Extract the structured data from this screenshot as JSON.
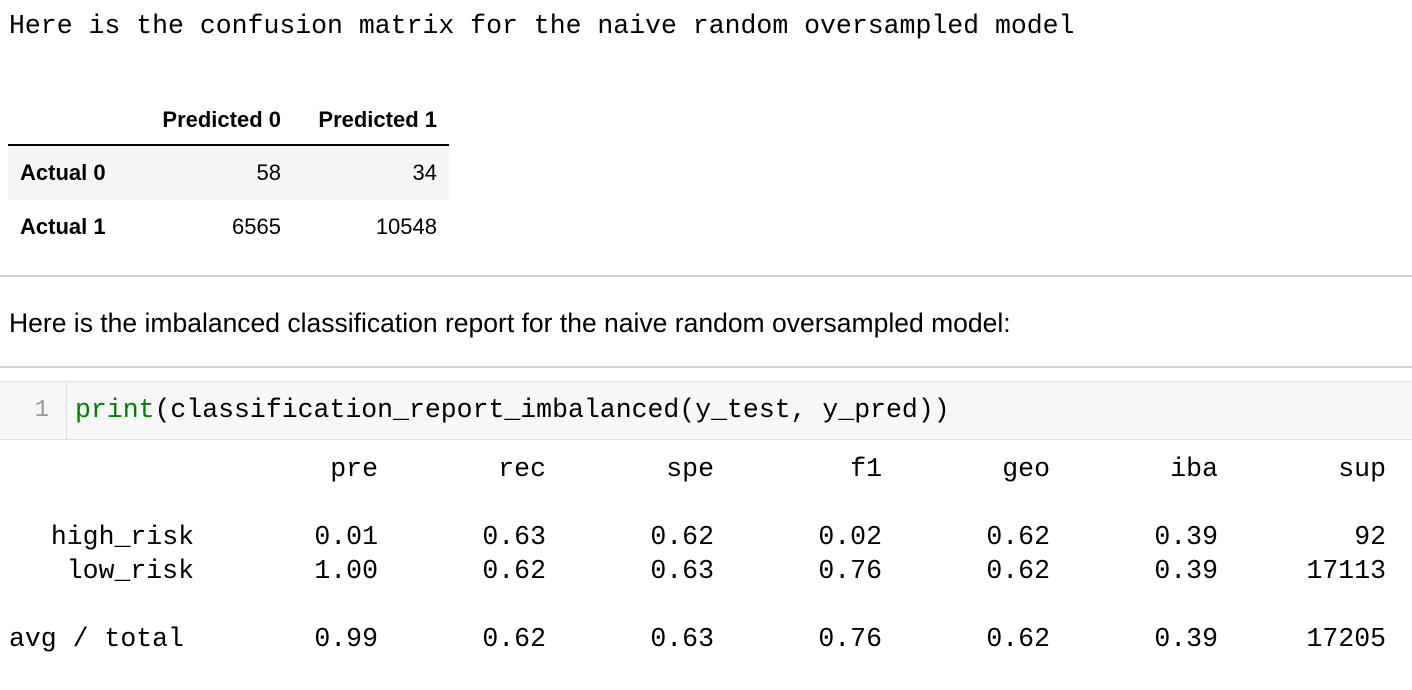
{
  "intro_text": "Here is the confusion matrix for the naive random oversampled model",
  "confusion_matrix": {
    "columns": [
      "Predicted 0",
      "Predicted 1"
    ],
    "rows": [
      {
        "label": "Actual 0",
        "values": [
          "58",
          "34"
        ]
      },
      {
        "label": "Actual 1",
        "values": [
          "6565",
          "10548"
        ]
      }
    ]
  },
  "report_heading": "Here is the imbalanced classification report for the naive random oversampled model:",
  "code_cell": {
    "line_number": "1",
    "keyword": "print",
    "rest": "(classification_report_imbalanced(y_test, y_pred))"
  },
  "report": {
    "headers": [
      "pre",
      "rec",
      "spe",
      "f1",
      "geo",
      "iba",
      "sup"
    ],
    "rows": [
      {
        "label": "high_risk",
        "values": [
          "0.01",
          "0.63",
          "0.62",
          "0.02",
          "0.62",
          "0.39",
          "92"
        ]
      },
      {
        "label": "low_risk",
        "values": [
          "1.00",
          "0.62",
          "0.63",
          "0.76",
          "0.62",
          "0.39",
          "17113"
        ]
      }
    ],
    "total": {
      "label": "avg / total",
      "values": [
        "0.99",
        "0.62",
        "0.63",
        "0.76",
        "0.62",
        "0.39",
        "17205"
      ]
    }
  }
}
